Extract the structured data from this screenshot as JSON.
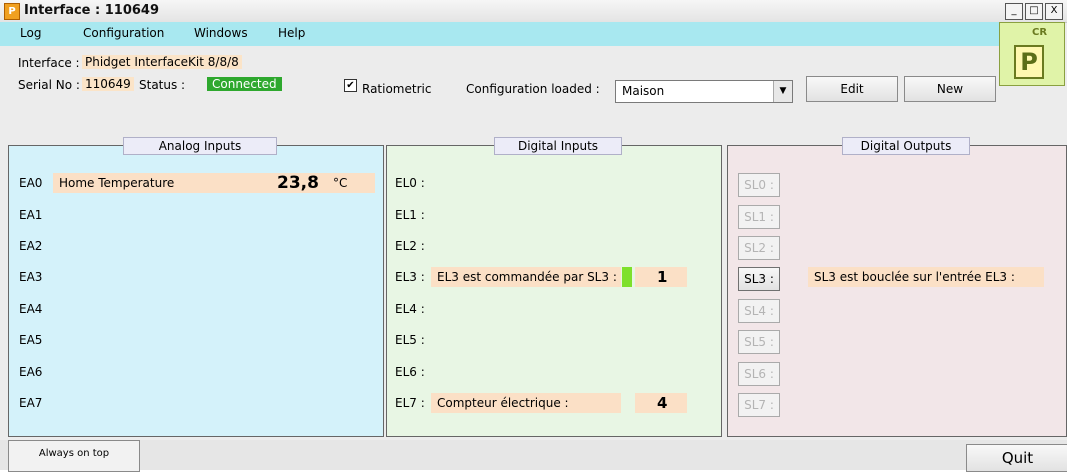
{
  "window": {
    "title": "Interface : 110649",
    "app_icon": "P",
    "controls": {
      "minimize": "_",
      "maximize": "□",
      "close": "X"
    }
  },
  "menu": [
    "Log",
    "Configuration",
    "Windows",
    "Help"
  ],
  "logo": {
    "letter": "P",
    "text": "CR"
  },
  "info": {
    "interface_label": "Interface :",
    "interface_value": "Phidget InterfaceKit 8/8/8",
    "serial_label": "Serial No :",
    "serial_value": "110649",
    "status_label": "Status :",
    "status_value": "Connected",
    "ratiometric_label": "Ratiometric",
    "ratiometric_checked": true,
    "config_label": "Configuration loaded :",
    "config_value": "Maison",
    "edit_label": "Edit",
    "new_label": "New"
  },
  "analog": {
    "title": "Analog Inputs",
    "rows": [
      {
        "id": "EA0",
        "name": "Home Temperature",
        "value": "23,8",
        "unit": "°C"
      },
      {
        "id": "EA1"
      },
      {
        "id": "EA2"
      },
      {
        "id": "EA3"
      },
      {
        "id": "EA4"
      },
      {
        "id": "EA5"
      },
      {
        "id": "EA6"
      },
      {
        "id": "EA7"
      }
    ]
  },
  "digital_inputs": {
    "title": "Digital  Inputs",
    "rows": [
      {
        "id": "EL0 :"
      },
      {
        "id": "EL1 :"
      },
      {
        "id": "EL2 :"
      },
      {
        "id": "EL3 :",
        "name": "EL3 est commandée par SL3 :",
        "value": "1",
        "indicator": "#7ee02c"
      },
      {
        "id": "EL4 :"
      },
      {
        "id": "EL5 :"
      },
      {
        "id": "EL6 :"
      },
      {
        "id": "EL7 :",
        "name": "Compteur électrique :",
        "value": "4"
      }
    ]
  },
  "digital_outputs": {
    "title": "Digital Outputs",
    "rows": [
      {
        "id": "SL0 :",
        "enabled": false
      },
      {
        "id": "SL1 :",
        "enabled": false
      },
      {
        "id": "SL2 :",
        "enabled": false
      },
      {
        "id": "SL3 :",
        "enabled": true,
        "name": "SL3 est bouclée sur l'entrée EL3 :"
      },
      {
        "id": "SL4 :",
        "enabled": false
      },
      {
        "id": "SL5 :",
        "enabled": false
      },
      {
        "id": "SL6 :",
        "enabled": false
      },
      {
        "id": "SL7 :",
        "enabled": false
      }
    ]
  },
  "bottom": {
    "always_on_top": "Always on top",
    "quit": "Quit"
  },
  "colors": {
    "menu_bg": "#a8e8f0",
    "analog_bg": "#d4f2fa",
    "digital_in_bg": "#e8f6e4",
    "digital_out_bg": "#f2e6e8",
    "status_ok": "#2ea82e"
  }
}
